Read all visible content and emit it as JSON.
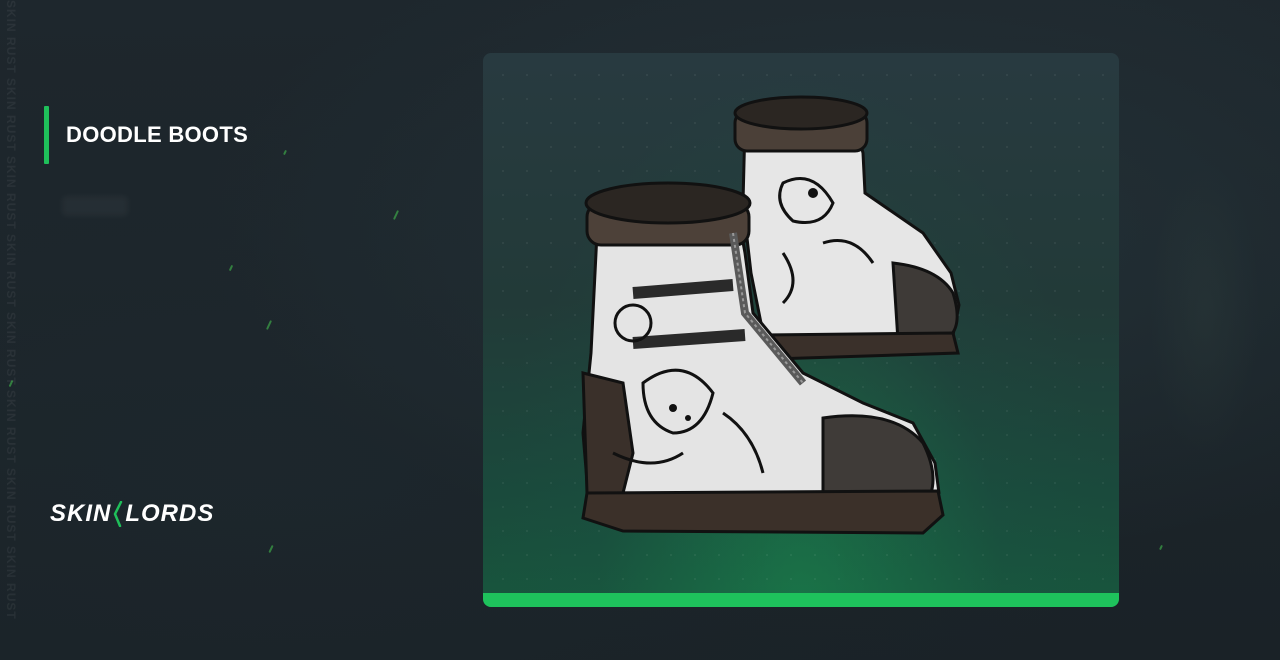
{
  "product": {
    "title": "DOODLE BOOTS"
  },
  "background": {
    "side_text": "SKIN RUST SKIN RUST SKIN RUST SKIN RUST SKIN RUST SKIN RUST SKIN RUST SKIN RUST"
  },
  "brand": {
    "logo_text_left": "SKIN",
    "logo_text_right": "LORDS"
  },
  "colors": {
    "accent": "#1fbf5a",
    "background": "#1c242a",
    "card_top": "#283a40",
    "card_bottom": "#18563d"
  },
  "icons": {
    "item_image": "doodle-boots-image"
  }
}
